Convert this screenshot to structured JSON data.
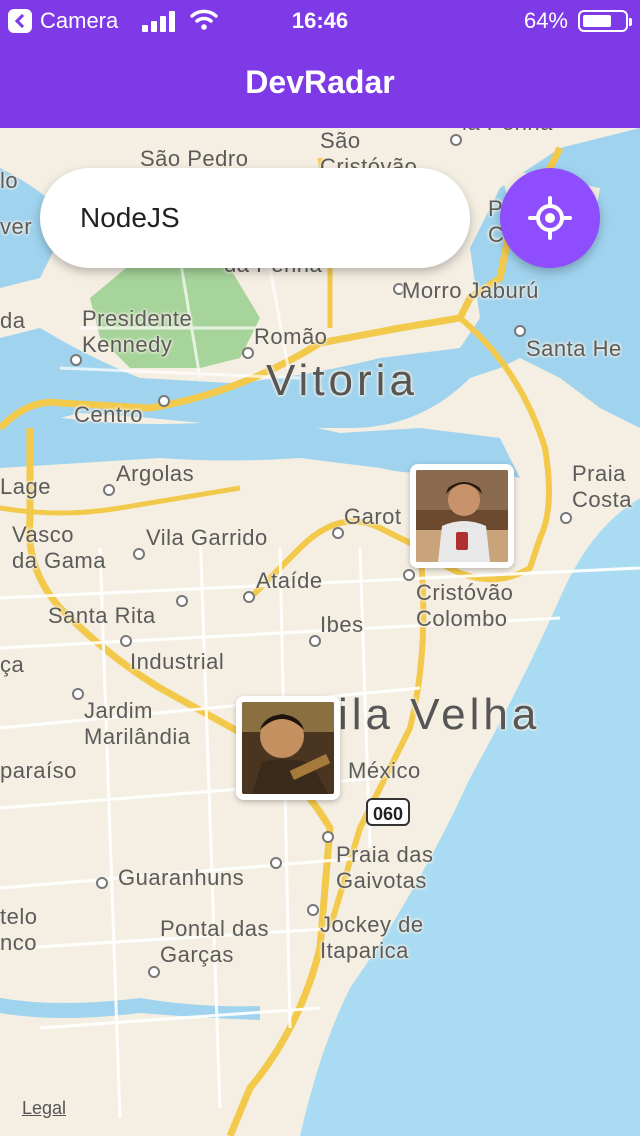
{
  "status_bar": {
    "back_app": "Camera",
    "time": "16:46",
    "battery": "64%"
  },
  "navbar": {
    "title": "DevRadar"
  },
  "search": {
    "value": "NodeJS"
  },
  "map": {
    "city_labels": [
      "Vitoria",
      "ila Velha"
    ],
    "places": [
      "São Pedro",
      "São\nCristóvão",
      "da Penha",
      "Morro Jaburú",
      "Presidente\nKennedy",
      "Romão",
      "Santa He",
      "Centro",
      "Argolas",
      "Lage",
      "Vasco\nda Gama",
      "Vila Garrido",
      "Garot",
      "Praia\nCosta",
      "Ataíde",
      "Cristóvão\nColombo",
      "Santa Rita",
      "Ibes",
      "Industrial",
      "ça",
      "Jardim\nMarilândia",
      "México",
      "paraíso",
      "Praia das\nGaivotas",
      "Guaranhuns",
      "telo\nnco",
      "Pontal das\nGarças",
      "Jockey de\nItaparica",
      "lo",
      "ver",
      "da",
      "P\nC",
      "ia Penha"
    ],
    "route_shield": "060",
    "legal": "Legal"
  }
}
